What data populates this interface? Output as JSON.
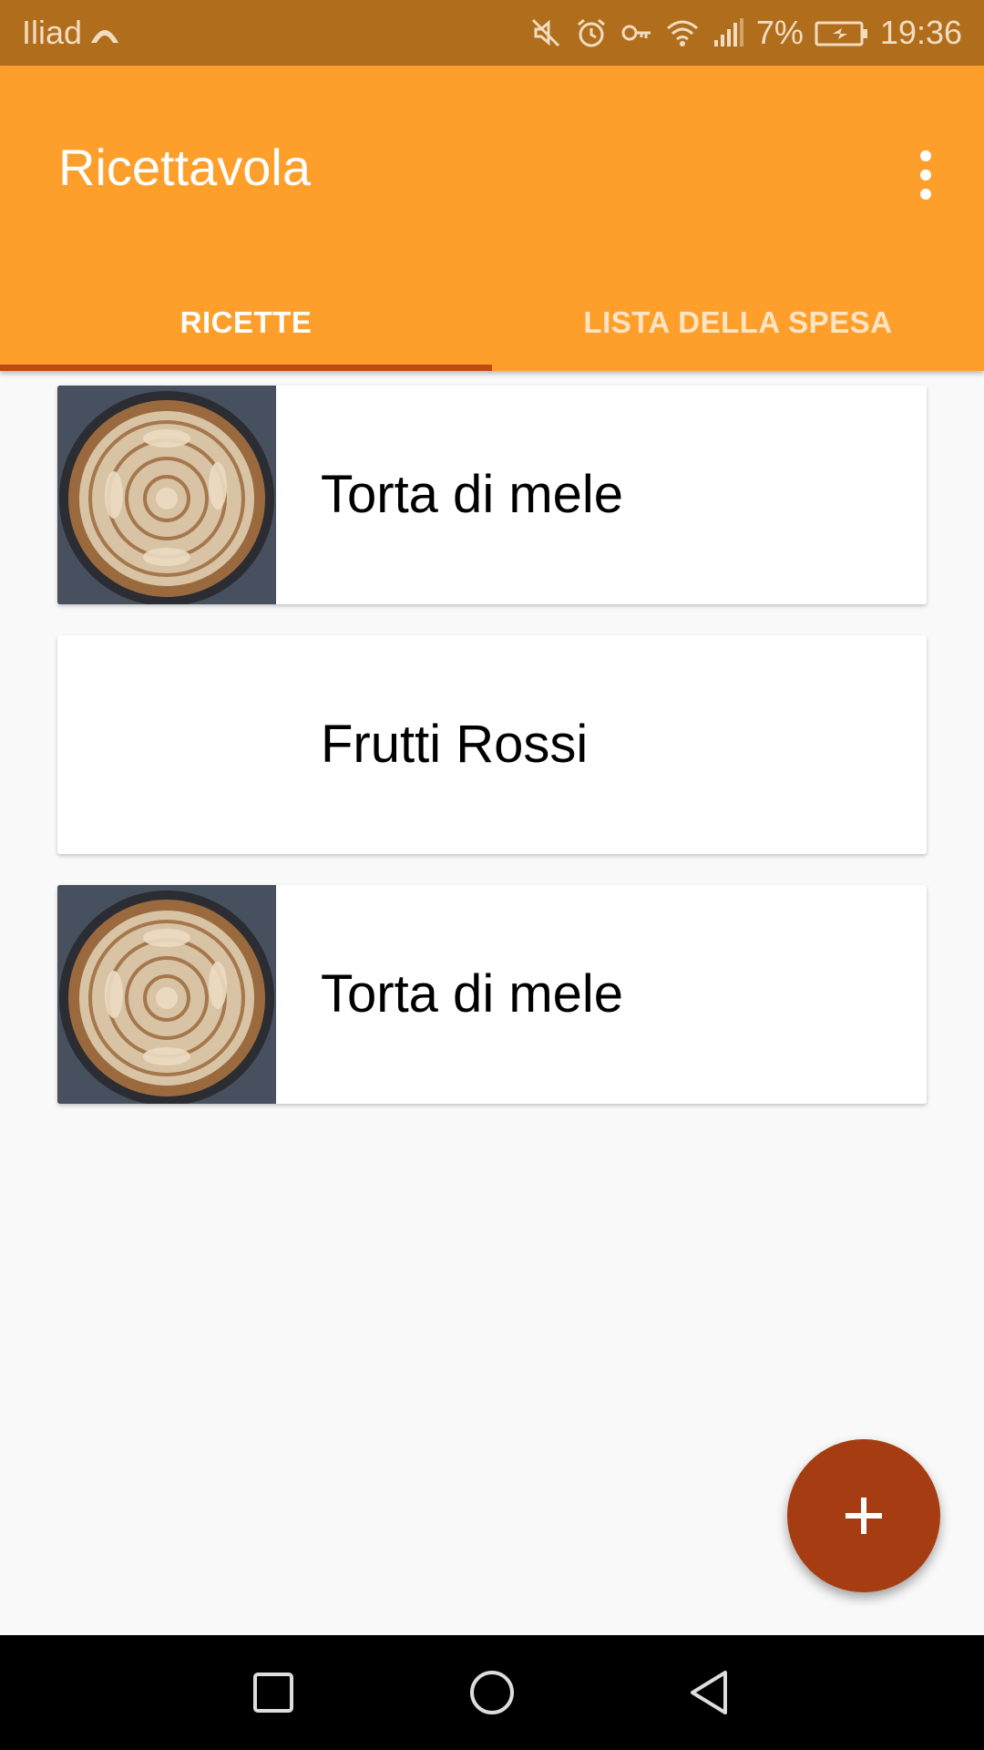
{
  "status_bar": {
    "carrier": "Iliad",
    "battery": "7%",
    "time": "19:36",
    "icons": [
      "mute-icon",
      "alarm-icon",
      "vpn-key-icon",
      "wifi-icon",
      "signal-icon",
      "battery-charging-icon"
    ]
  },
  "app_bar": {
    "title": "Ricettavola",
    "menu_icon": "more-vert-icon"
  },
  "tabs": [
    {
      "label": "RICETTE",
      "selected": true
    },
    {
      "label": "LISTA DELLA SPESA",
      "selected": false
    }
  ],
  "recipes": [
    {
      "title": "Torta di mele",
      "has_image": true
    },
    {
      "title": "Frutti Rossi",
      "has_image": false
    },
    {
      "title": "Torta di mele",
      "has_image": true
    }
  ],
  "fab": {
    "icon": "add-icon"
  },
  "nav_bar": {
    "icons": [
      "recents-icon",
      "home-icon",
      "back-icon"
    ]
  },
  "colors": {
    "status_bar": "#b06e1d",
    "primary": "#fe9f2b",
    "accent": "#a63d12",
    "tab_indicator": "#bf4a14"
  }
}
